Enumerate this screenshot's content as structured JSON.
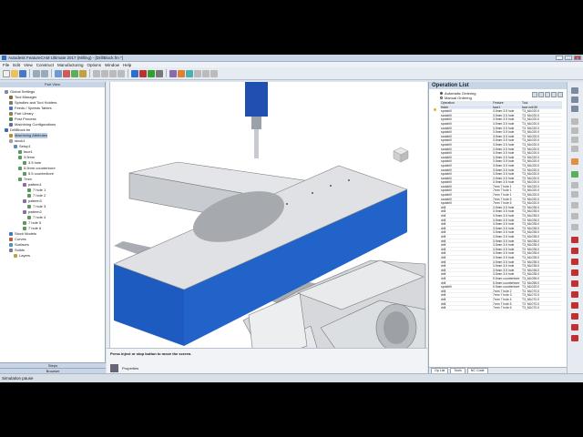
{
  "window": {
    "title": "Autodesk FeatureCAM Ultimate 2017 (Milling) - [DrillBlock.fm *]",
    "controls": [
      "_",
      "□",
      "×"
    ]
  },
  "menu": [
    "File",
    "Edit",
    "View",
    "Construct",
    "Manufacturing",
    "Options",
    "Window",
    "Help"
  ],
  "left_panel": {
    "title": "Part View",
    "tree": [
      {
        "label": "Global Settings",
        "indent": 1,
        "icon": "gear-icon",
        "color": "#7a8aa0"
      },
      {
        "label": "Tool Manager",
        "indent": 2,
        "icon": "tool-icon",
        "color": "#8a6a3a"
      },
      {
        "label": "Spindles and Tool Holders",
        "indent": 2,
        "icon": "spindle-icon",
        "color": "#7a7a7a"
      },
      {
        "label": "Feeds / Speeds Tables",
        "indent": 2,
        "icon": "table-icon",
        "color": "#3a7abf"
      },
      {
        "label": "Part Library",
        "indent": 2,
        "icon": "library-icon",
        "color": "#9a7a4a"
      },
      {
        "label": "Post Process",
        "indent": 2,
        "icon": "post-icon",
        "color": "#4a8a4a"
      },
      {
        "label": "Machining Configurations",
        "indent": 2,
        "icon": "config-icon",
        "color": "#6a6a9a"
      },
      {
        "label": "DrillBlock.fm",
        "indent": 1,
        "icon": "document-icon",
        "color": "#3a6ab0"
      },
      {
        "label": "Machining Attributes",
        "indent": 2,
        "icon": "attributes-icon",
        "color": "#c08a2a",
        "selected": true
      },
      {
        "label": "stock1",
        "indent": 2,
        "icon": "stock-icon",
        "color": "#a0a0a0"
      },
      {
        "label": "Setup1",
        "indent": 3,
        "icon": "setup-icon",
        "color": "#5a8ac0"
      },
      {
        "label": "face1",
        "indent": 4,
        "icon": "face-icon",
        "color": "#5a9a5a"
      },
      {
        "label": "3.5mm",
        "indent": 4,
        "icon": "hole-icon",
        "color": "#5a9a5a"
      },
      {
        "label": "3.5 hole",
        "indent": 5,
        "icon": "hole-icon",
        "color": "#5a9a5a"
      },
      {
        "label": "5.5mm counterbore",
        "indent": 4,
        "icon": "hole-icon",
        "color": "#5a9a5a"
      },
      {
        "label": "5.5 counterbore",
        "indent": 5,
        "icon": "hole-icon",
        "color": "#5a9a5a"
      },
      {
        "label": "7mm",
        "indent": 4,
        "icon": "hole-icon",
        "color": "#5a9a5a"
      },
      {
        "label": "pattern1",
        "indent": 5,
        "icon": "pattern-icon",
        "color": "#8a6ab0"
      },
      {
        "label": "7 hole 1",
        "indent": 6,
        "icon": "hole-icon",
        "color": "#5a9a5a"
      },
      {
        "label": "7 hole 2",
        "indent": 6,
        "icon": "hole-icon",
        "color": "#5a9a5a"
      },
      {
        "label": "pattern3",
        "indent": 5,
        "icon": "pattern-icon",
        "color": "#8a6ab0"
      },
      {
        "label": "7 hole 3",
        "indent": 6,
        "icon": "hole-icon",
        "color": "#5a9a5a"
      },
      {
        "label": "pattern2",
        "indent": 5,
        "icon": "pattern-icon",
        "color": "#8a6ab0"
      },
      {
        "label": "7 hole 4",
        "indent": 6,
        "icon": "hole-icon",
        "color": "#5a9a5a"
      },
      {
        "label": "7 hole 5",
        "indent": 5,
        "icon": "hole-icon",
        "color": "#5a9a5a"
      },
      {
        "label": "7 hole 6",
        "indent": 5,
        "icon": "hole-icon",
        "color": "#5a9a5a"
      },
      {
        "label": "Stock Models",
        "indent": 2,
        "icon": "stock-model-icon",
        "color": "#3a7abf"
      },
      {
        "label": "Curves",
        "indent": 2,
        "icon": "curve-icon",
        "color": "#bf5a3a"
      },
      {
        "label": "Surfaces",
        "indent": 2,
        "icon": "surface-icon",
        "color": "#3a9abf"
      },
      {
        "label": "Solids",
        "indent": 2,
        "icon": "solid-icon",
        "color": "#7a7a9a"
      },
      {
        "label": "Layers",
        "indent": 3,
        "icon": "layer-icon",
        "color": "#bfa03a"
      }
    ],
    "bottom_tabs": [
      "Steps",
      "Browser"
    ]
  },
  "viewport": {
    "message": "Press inject or stop button to move the screen.",
    "properties_label": "Properties",
    "stock_color": "#1e5bc0"
  },
  "operation_list": {
    "title": "Operation List",
    "radio": [
      {
        "label": "Automatic Ordering",
        "checked": true
      },
      {
        "label": "Manual Ordering",
        "checked": false
      }
    ],
    "headers": [
      "Operation",
      "Feature",
      "Tool"
    ],
    "rows": [
      [
        "finish",
        "face1",
        "face mill 80"
      ],
      [
        "spotdrill",
        "3.5mm 3.5 hole",
        "T3_ML020.0"
      ],
      [
        "spotdrill",
        "3.5mm 3.5 hole",
        "T3_ML020.0"
      ],
      [
        "spotdrill",
        "3.5mm 3.5 hole",
        "T3_ML020.0"
      ],
      [
        "spotdrill",
        "3.5mm 3.5 hole",
        "T3_ML020.0"
      ],
      [
        "spotdrill",
        "3.5mm 3.5 hole",
        "T3_ML020.0"
      ],
      [
        "spotdrill",
        "3.5mm 3.5 hole",
        "T3_ML020.0"
      ],
      [
        "spotdrill",
        "3.5mm 3.5 hole",
        "T3_ML020.0"
      ],
      [
        "spotdrill",
        "3.5mm 3.5 hole",
        "T3_ML020.0"
      ],
      [
        "spotdrill",
        "3.5mm 3.5 hole",
        "T3_ML020.0"
      ],
      [
        "spotdrill",
        "3.5mm 3.5 hole",
        "T3_ML020.0"
      ],
      [
        "spotdrill",
        "3.5mm 3.5 hole",
        "T3_ML020.0"
      ],
      [
        "spotdrill",
        "3.5mm 3.5 hole",
        "T3_ML020.0"
      ],
      [
        "spotdrill",
        "3.5mm 3.5 hole",
        "T3_ML020.0"
      ],
      [
        "spotdrill",
        "3.5mm 3.5 hole",
        "T3_ML020.0"
      ],
      [
        "spotdrill",
        "3.5mm 3.5 hole",
        "T3_ML020.0"
      ],
      [
        "spotdrill",
        "3.5mm 3.5 hole",
        "T3_ML020.0"
      ],
      [
        "spotdrill",
        "3.5mm 3.5 hole",
        "T3_ML020.0"
      ],
      [
        "spotdrill",
        "3.5mm 3.5 hole",
        "T3_ML020.0"
      ],
      [
        "spotdrill",
        "7mm 7 hole 1",
        "T3_ML020.0"
      ],
      [
        "spotdrill",
        "7mm 7 hole 1",
        "T3_ML020.0"
      ],
      [
        "spotdrill",
        "7mm 7 hole 1",
        "T3_ML020.0"
      ],
      [
        "spotdrill",
        "7mm 7 hole 5",
        "T3_ML020.0"
      ],
      [
        "spotdrill",
        "7mm 7 hole 6",
        "T3_ML020.0"
      ],
      [
        "drill",
        "3.5mm 3.5 hole",
        "T3_ML035.0"
      ],
      [
        "drill",
        "3.5mm 3.5 hole",
        "T3_ML035.0"
      ],
      [
        "drill",
        "3.5mm 3.5 hole",
        "T3_ML035.0"
      ],
      [
        "drill",
        "3.5mm 3.5 hole",
        "T3_ML035.0"
      ],
      [
        "drill",
        "3.5mm 3.5 hole",
        "T3_ML035.0"
      ],
      [
        "drill",
        "3.5mm 3.5 hole",
        "T3_ML035.0"
      ],
      [
        "drill",
        "3.5mm 3.5 hole",
        "T3_ML035.0"
      ],
      [
        "drill",
        "3.5mm 3.5 hole",
        "T3_ML035.0"
      ],
      [
        "drill",
        "3.5mm 3.5 hole",
        "T3_ML035.0"
      ],
      [
        "drill",
        "3.5mm 3.5 hole",
        "T3_ML035.0"
      ],
      [
        "drill",
        "3.5mm 3.5 hole",
        "T3_ML035.0"
      ],
      [
        "drill",
        "3.5mm 3.5 hole",
        "T3_ML035.0"
      ],
      [
        "drill",
        "3.5mm 3.5 hole",
        "T3_ML035.0"
      ],
      [
        "drill",
        "3.5mm 3.5 hole",
        "T3_ML035.0"
      ],
      [
        "drill",
        "3.5mm 3.5 hole",
        "T3_ML035.0"
      ],
      [
        "drill",
        "3.5mm 3.5 hole",
        "T3_ML035.0"
      ],
      [
        "drill",
        "3.5mm 3.5 hole",
        "T3_ML035.0"
      ],
      [
        "drill",
        "5.5mm counterbore",
        "T3_ML055.0"
      ],
      [
        "drill",
        "5.5mm counterbore",
        "T3_ML055.0"
      ],
      [
        "spotdrill",
        "5.5mm counterbore",
        "T3_ML020.0"
      ],
      [
        "drill",
        "7mm 7 hole 2",
        "T3_ML070.0"
      ],
      [
        "drill",
        "7mm 7 hole 3",
        "T3_ML070.0"
      ],
      [
        "drill",
        "7mm 7 hole 4",
        "T3_ML070.0"
      ],
      [
        "drill",
        "7mm 7 hole 5",
        "T3_ML070.0"
      ],
      [
        "drill",
        "7mm 7 hole 6",
        "T3_ML070.0"
      ]
    ],
    "bottom_tabs": [
      "Op List",
      "Tools",
      "NC Code"
    ]
  },
  "status": "Simulation pause"
}
